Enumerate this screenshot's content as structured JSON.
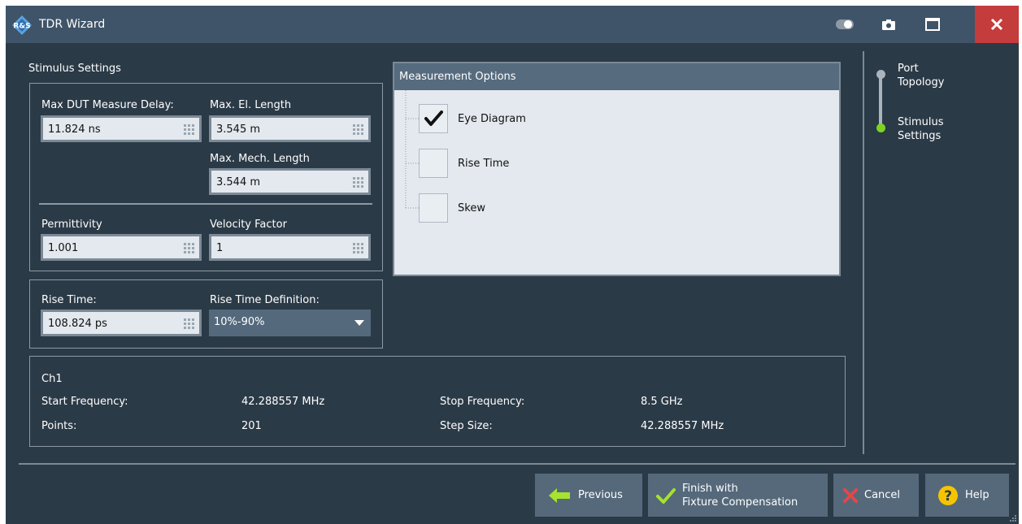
{
  "window": {
    "title": "TDR Wizard"
  },
  "stimulus": {
    "section_label": "Stimulus Settings",
    "max_dut_delay": {
      "label": "Max DUT Measure Delay:",
      "value": "11.824 ns"
    },
    "max_el_length": {
      "label": "Max. El. Length",
      "value": "3.545 m"
    },
    "max_mech_length": {
      "label": "Max. Mech. Length",
      "value": "3.544 m"
    },
    "permittivity": {
      "label": "Permittivity",
      "value": "1.001"
    },
    "velocity_factor": {
      "label": "Velocity Factor",
      "value": "1"
    },
    "rise_time": {
      "label": "Rise Time:",
      "value": "108.824 ps"
    },
    "rise_time_definition": {
      "label": "Rise Time Definition:",
      "value": "10%-90%"
    }
  },
  "measurement_options": {
    "title": "Measurement Options",
    "items": [
      {
        "label": "Eye Diagram",
        "checked": true
      },
      {
        "label": "Rise Time",
        "checked": false
      },
      {
        "label": "Skew",
        "checked": false
      }
    ]
  },
  "steps": [
    {
      "label_line1": "Port",
      "label_line2": "Topology",
      "active": false
    },
    {
      "label_line1": "Stimulus",
      "label_line2": "Settings",
      "active": true
    }
  ],
  "channel": {
    "name": "Ch1",
    "start_frequency_label": "Start Frequency:",
    "start_frequency": "42.288557 MHz",
    "stop_frequency_label": "Stop Frequency:",
    "stop_frequency": "8.5 GHz",
    "points_label": "Points:",
    "points": "201",
    "step_size_label": "Step Size:",
    "step_size": "42.288557 MHz"
  },
  "buttons": {
    "previous": "Previous",
    "finish_line1": "Finish with",
    "finish_line2": "Fixture Compensation",
    "cancel": "Cancel",
    "help": "Help"
  },
  "colors": {
    "background": "#2b3a47",
    "titlebar": "#3f5468",
    "close": "#c53c3c",
    "step_active": "#7ed321",
    "button": "#55697b"
  },
  "icons": {
    "toggle": "toggle-icon",
    "camera": "camera-icon",
    "maximize": "maximize-icon",
    "close": "close-icon",
    "previous": "arrow-left-icon",
    "finish": "checkmark-icon",
    "cancel": "cross-icon",
    "help": "help-icon"
  }
}
